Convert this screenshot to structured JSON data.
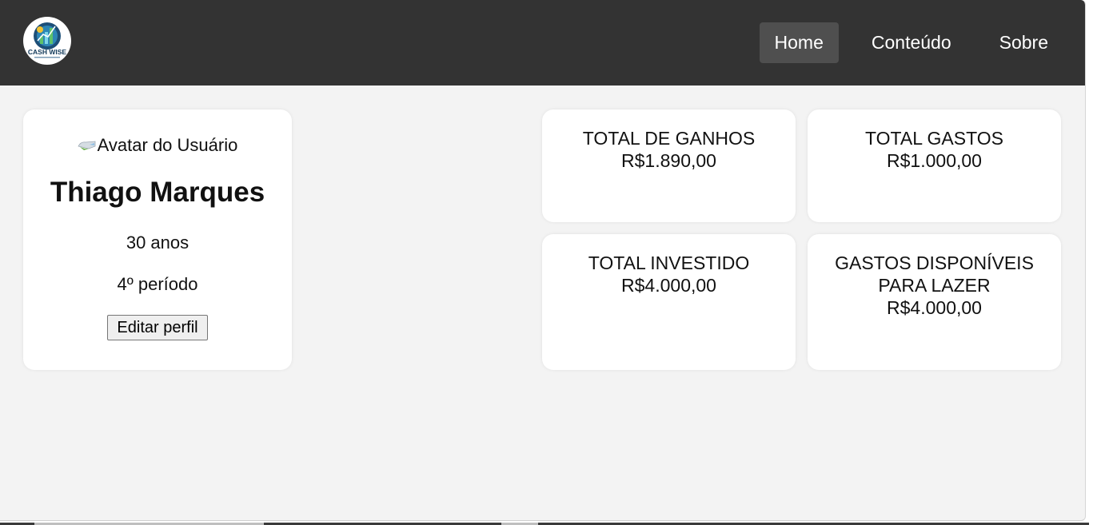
{
  "logo": {
    "text": "CASH WISE",
    "icon": "cash-wise-logo-icon"
  },
  "nav": {
    "items": [
      {
        "label": "Home",
        "active": true
      },
      {
        "label": "Conteúdo"
      },
      {
        "label": "Sobre"
      }
    ]
  },
  "profile": {
    "avatar_alt": "Avatar do Usuário",
    "name": "Thiago Marques",
    "age": "30 anos",
    "period": "4º período",
    "edit_label": "Editar perfil"
  },
  "stats": [
    {
      "title": "TOTAL DE GANHOS",
      "value": "R$1.890,00"
    },
    {
      "title": "TOTAL GASTOS",
      "value": "R$1.000,00"
    },
    {
      "title": "TOTAL INVESTIDO",
      "value": "R$4.000,00"
    },
    {
      "title": "GASTOS DISPONÍVEIS PARA LAZER",
      "value": "R$4.000,00"
    }
  ],
  "colors": {
    "navbar": "#333333",
    "nav_active": "#4f4f4f",
    "page_bg": "#f3f3f3",
    "card_bg": "#ffffff"
  }
}
